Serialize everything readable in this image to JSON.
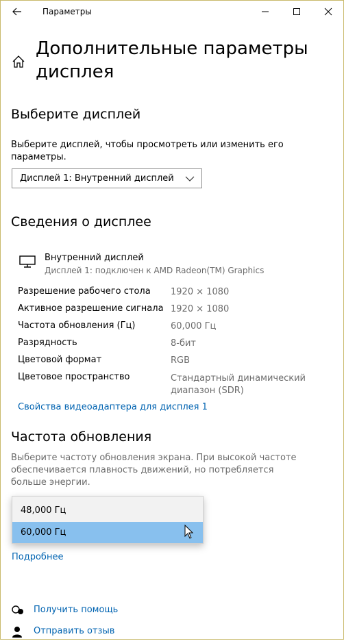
{
  "window": {
    "title": "Параметры"
  },
  "page_title": "Дополнительные параметры дисплея",
  "select_display": {
    "heading": "Выберите дисплей",
    "description": "Выберите дисплей, чтобы просмотреть или изменить его параметры.",
    "dropdown_value": "Дисплей 1: Внутренний дисплей"
  },
  "display_info": {
    "heading": "Сведения о дисплее",
    "name": "Внутренний дисплей",
    "subtitle": "Дисплей 1: подключен к AMD Radeon(TM) Graphics",
    "rows": [
      {
        "label": "Разрешение рабочего стола",
        "value": "1920 × 1080"
      },
      {
        "label": "Активное разрешение сигнала",
        "value": "1920 × 1080"
      },
      {
        "label": "Частота обновления (Гц)",
        "value": "60,000 Гц"
      },
      {
        "label": "Разрядность",
        "value": "8-бит"
      },
      {
        "label": "Цветовой формат",
        "value": "RGB"
      },
      {
        "label": "Цветовое пространство",
        "value": "Стандартный динамический диапазон (SDR)"
      }
    ],
    "adapter_link": "Свойства видеоадаптера для дисплея 1"
  },
  "refresh": {
    "heading": "Частота обновления",
    "description": "Выберите частоту обновления экрана. При высокой частоте обеспечивается плавность движений, но потребляется больше энергии.",
    "options": [
      "48,000 Гц",
      "60,000 Гц"
    ],
    "selected": "60,000 Гц",
    "more_link": "Подробнее"
  },
  "footer": {
    "help": "Получить помощь",
    "feedback": "Отправить отзыв"
  },
  "colors": {
    "accent": "#0063b1",
    "selected_option": "#88c0ee"
  }
}
